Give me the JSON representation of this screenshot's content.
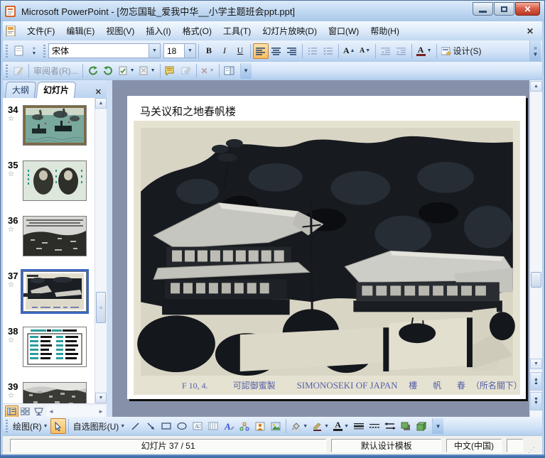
{
  "window": {
    "title": "Microsoft PowerPoint - [勿忘国耻_爱我中华__小学主题班会ppt.ppt]"
  },
  "icons": {
    "close": "✕",
    "dropdown": "▼",
    "up": "▲",
    "down": "▼",
    "left": "◄",
    "right": "►",
    "star": "☆",
    "ellipsis_chevron": "»"
  },
  "menu": {
    "items": [
      "文件(F)",
      "编辑(E)",
      "视图(V)",
      "插入(I)",
      "格式(O)",
      "工具(T)",
      "幻灯片放映(D)",
      "窗口(W)",
      "帮助(H)"
    ]
  },
  "format_toolbar": {
    "font_name": "宋体",
    "font_size": "18",
    "bold": "B",
    "italic": "I",
    "underline": "U",
    "grow_letter": "A",
    "shrink_letter": "A",
    "font_color_letter": "A",
    "design_label": "设计(S)"
  },
  "review_toolbar": {
    "reviewers_label": "审阅者(R)...",
    "delete_glyph": "✕"
  },
  "pane": {
    "tab_outline": "大纲",
    "tab_slides": "幻灯片"
  },
  "thumbnails": [
    {
      "number": "34"
    },
    {
      "number": "35"
    },
    {
      "number": "36"
    },
    {
      "number": "37",
      "selected": true
    },
    {
      "number": "38"
    },
    {
      "number": "39"
    }
  ],
  "slide": {
    "title": "马关议和之地春帆楼",
    "caption": {
      "code": "F 10, 4.",
      "stamp": "可認御蜜製",
      "name": "SIMONOSEKI OF JAPAN",
      "kanji1": "樓",
      "kanji2": "帆",
      "kanji3": "春",
      "suffix": "（所名關下）"
    }
  },
  "draw_toolbar": {
    "draw_label": "绘图(R)",
    "autoshapes_label": "自选图形(U)"
  },
  "status_bar": {
    "slide_position": "幻灯片 37 / 51",
    "design_template": "默认设计模板",
    "language": "中文(中国)"
  },
  "colors": {
    "selection_blue": "#3a66c0",
    "toolbar_highlight": "#f8bc5e",
    "close_red": "#b83822",
    "caption_blue": "#5560a8"
  }
}
